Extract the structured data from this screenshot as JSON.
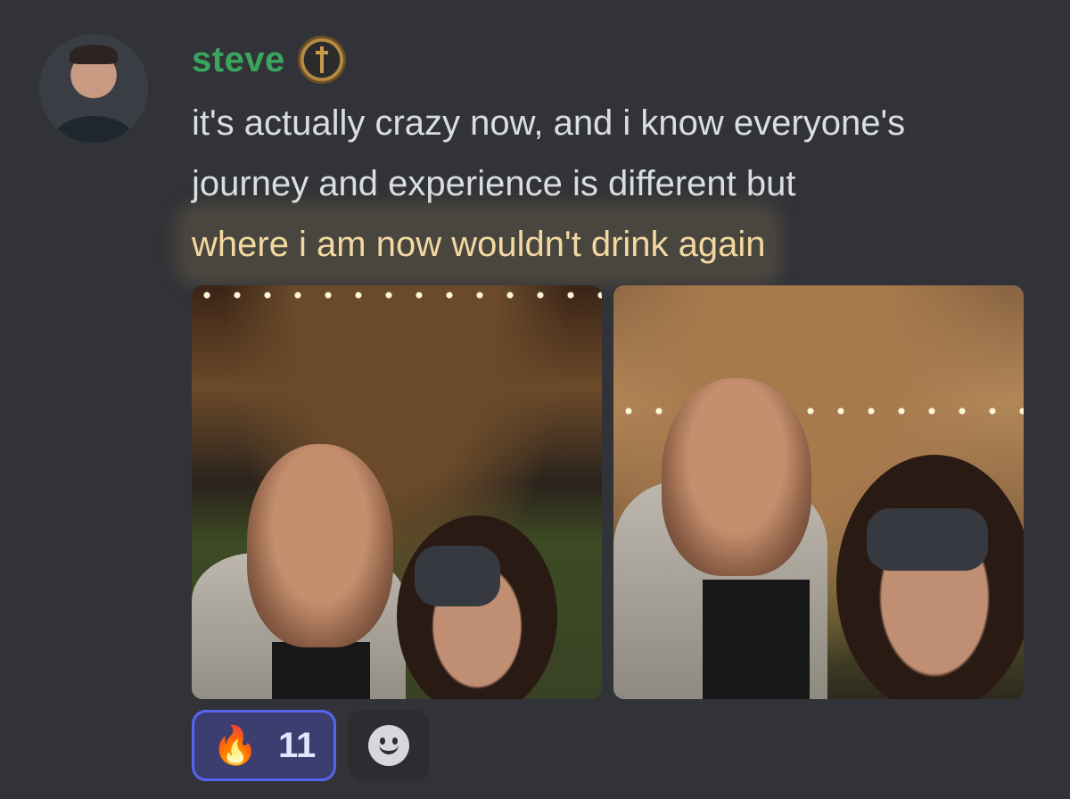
{
  "message": {
    "author": {
      "name": "steve",
      "name_color": "#3aa55c",
      "avatar": "avatar-photo",
      "badge_icon": "sword-badge-icon"
    },
    "lines": [
      "it's actually crazy now, and i know everyone's",
      "journey and experience is different but",
      "where i am now wouldn't drink again"
    ],
    "highlight_color": "#f3d9a0",
    "attachments": [
      {
        "type": "image",
        "description": "selfie-photo-1"
      },
      {
        "type": "image",
        "description": "selfie-photo-2"
      }
    ],
    "reactions": [
      {
        "emoji": "🔥",
        "icon": "fire-emoji-icon",
        "count": "11",
        "selected": true
      }
    ],
    "add_reaction_icon": "add-reaction-smiley-icon"
  },
  "colors": {
    "background": "#313338",
    "reaction_border": "#5865f2",
    "reaction_bg": "#3b3e6e"
  }
}
